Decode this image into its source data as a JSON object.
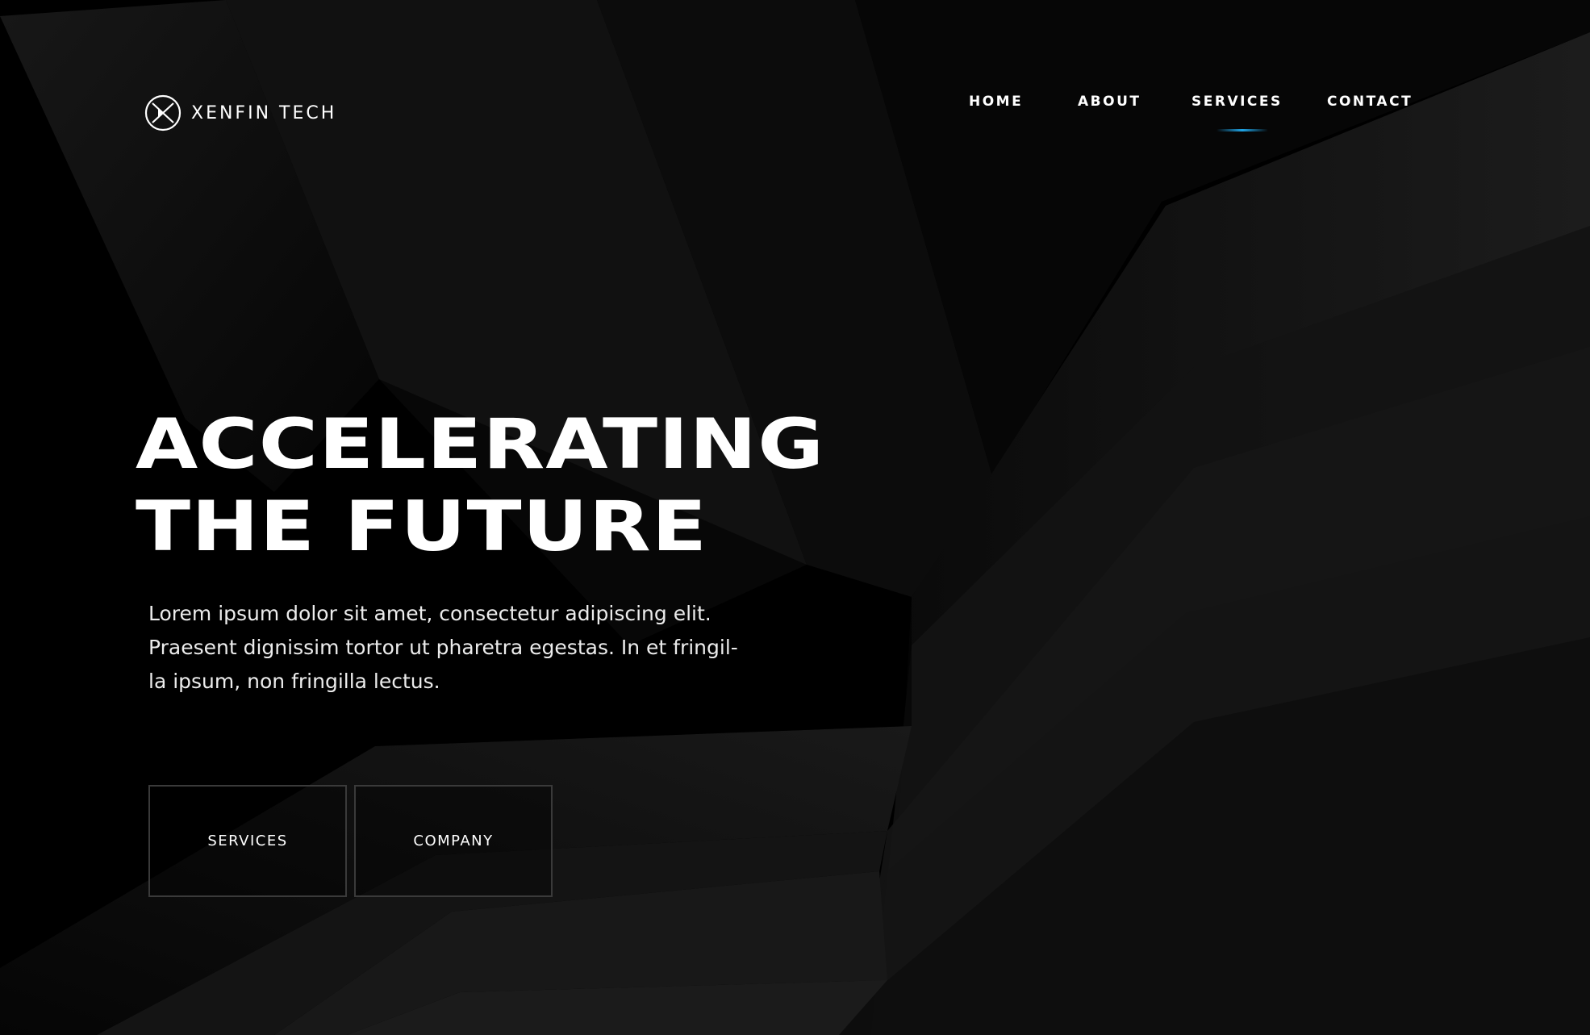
{
  "brand": {
    "name": "XENFIN TECH",
    "logo_icon": "x-circle-logo-icon"
  },
  "nav": {
    "items": [
      {
        "label": "HOME",
        "active": false
      },
      {
        "label": "ABOUT",
        "active": false
      },
      {
        "label": "SERVICES",
        "active": true
      },
      {
        "label": "CONTACT",
        "active": false
      }
    ],
    "active_indicator_color": "#1fa4e6"
  },
  "hero": {
    "title_lines": [
      "ACCELERATING",
      "THE FUTURE"
    ],
    "text_lines": [
      "Lorem ipsum dolor sit amet, consectetur adipiscing elit.",
      "Praesent dignissim tortor ut pharetra egestas. In et fringil-",
      "la ipsum, non fringilla lectus."
    ]
  },
  "buttons": {
    "primary": "SERVICES",
    "secondary": "COMPANY"
  },
  "colors": {
    "background": "#000000",
    "text": "#ffffff",
    "button_border": "#3a3a3a",
    "accent": "#1fa4e6"
  }
}
